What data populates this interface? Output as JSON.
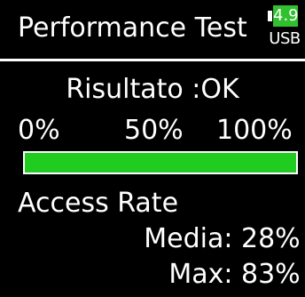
{
  "header": {
    "title": "Performance Test",
    "battery_voltage": "4.9",
    "power_source": "USB",
    "battery_color": "#31c02f"
  },
  "result": {
    "text": "Risultato :OK"
  },
  "progress": {
    "scale_min": "0%",
    "scale_mid": "50%",
    "scale_max": "100%",
    "fill_percent": 100,
    "fill_color": "#1fcc1f"
  },
  "access_rate": {
    "label": "Access Rate",
    "average_label": "Media:",
    "average_value": "28%",
    "max_label": "Max:",
    "max_value": "83%"
  }
}
